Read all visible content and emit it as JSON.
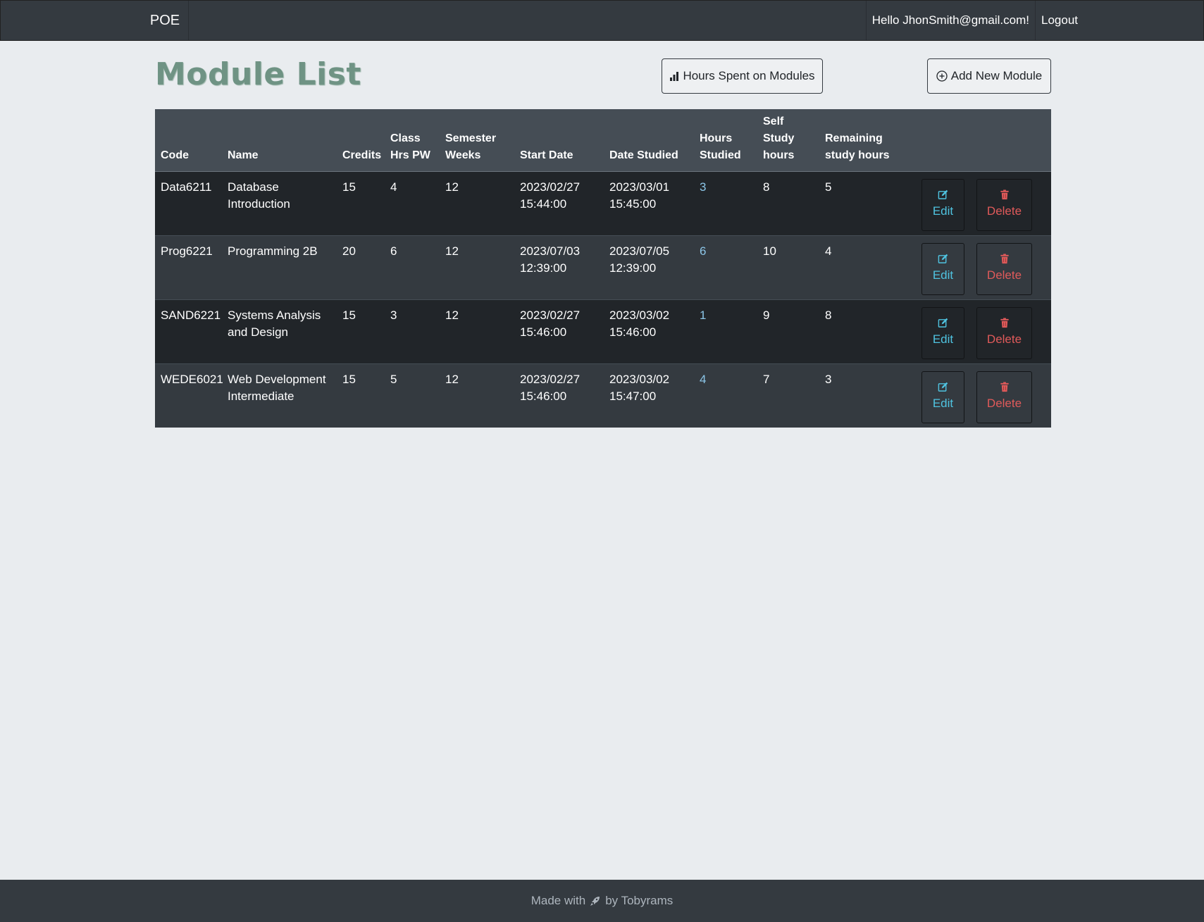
{
  "nav": {
    "brand": "POE",
    "greeting": "Hello JhonSmith@gmail.com!",
    "logout": "Logout"
  },
  "page": {
    "title": "Module List",
    "hours_button": "Hours Spent on Modules",
    "add_button": "Add New Module",
    "icons": {
      "hours": "bar-chart-icon",
      "add": "plus-circle-icon"
    }
  },
  "table": {
    "headers": {
      "code": "Code",
      "name": "Name",
      "credits": "Credits",
      "class_hrs_1": "Class",
      "class_hrs_2": "Hrs PW",
      "semester_1": "Semester",
      "semester_2": "Weeks",
      "start_date": "Start Date",
      "date_studied": "Date Studied",
      "hours_1": "Hours",
      "hours_2": "Studied",
      "self_1": "Self",
      "self_2": "Study",
      "self_3": "hours",
      "remaining_1": "Remaining",
      "remaining_2": "study hours"
    },
    "rows": [
      {
        "code": "Data6211",
        "name_1": "Database",
        "name_2": "Introduction",
        "credits": "15",
        "class_hrs": "4",
        "weeks": "12",
        "start_date": "2023/02/27",
        "start_time": "15:44:00",
        "studied_date": "2023/03/01",
        "studied_time": "15:45:00",
        "hours_studied": "3",
        "self_study": "8",
        "remaining": "5",
        "edit": "Edit",
        "delete": "Delete"
      },
      {
        "code": "Prog6221",
        "name_1": "Programming 2B",
        "name_2": "",
        "credits": "20",
        "class_hrs": "6",
        "weeks": "12",
        "start_date": "2023/07/03",
        "start_time": "12:39:00",
        "studied_date": "2023/07/05",
        "studied_time": "12:39:00",
        "hours_studied": "6",
        "self_study": "10",
        "remaining": "4",
        "edit": "Edit",
        "delete": "Delete"
      },
      {
        "code": "SAND6221",
        "name_1": "Systems Analysis",
        "name_2": "and Design",
        "credits": "15",
        "class_hrs": "3",
        "weeks": "12",
        "start_date": "2023/02/27",
        "start_time": "15:46:00",
        "studied_date": "2023/03/02",
        "studied_time": "15:46:00",
        "hours_studied": "1",
        "self_study": "9",
        "remaining": "8",
        "edit": "Edit",
        "delete": "Delete"
      },
      {
        "code": "WEDE6021",
        "name_1": "Web Development",
        "name_2": "Intermediate",
        "credits": "15",
        "class_hrs": "5",
        "weeks": "12",
        "start_date": "2023/02/27",
        "start_time": "15:46:00",
        "studied_date": "2023/03/02",
        "studied_time": "15:47:00",
        "hours_studied": "4",
        "self_study": "7",
        "remaining": "3",
        "edit": "Edit",
        "delete": "Delete"
      }
    ]
  },
  "footer": {
    "made_with": "Made with",
    "by": "by Tobyrams",
    "icon": "rocket-icon"
  },
  "colors": {
    "navbar": "#343a40",
    "page_bg": "#e9ecef",
    "title": "#6f9384",
    "edit": "#4fc3e0",
    "delete": "#e05a5a",
    "hours_link": "#8cc6e8"
  }
}
